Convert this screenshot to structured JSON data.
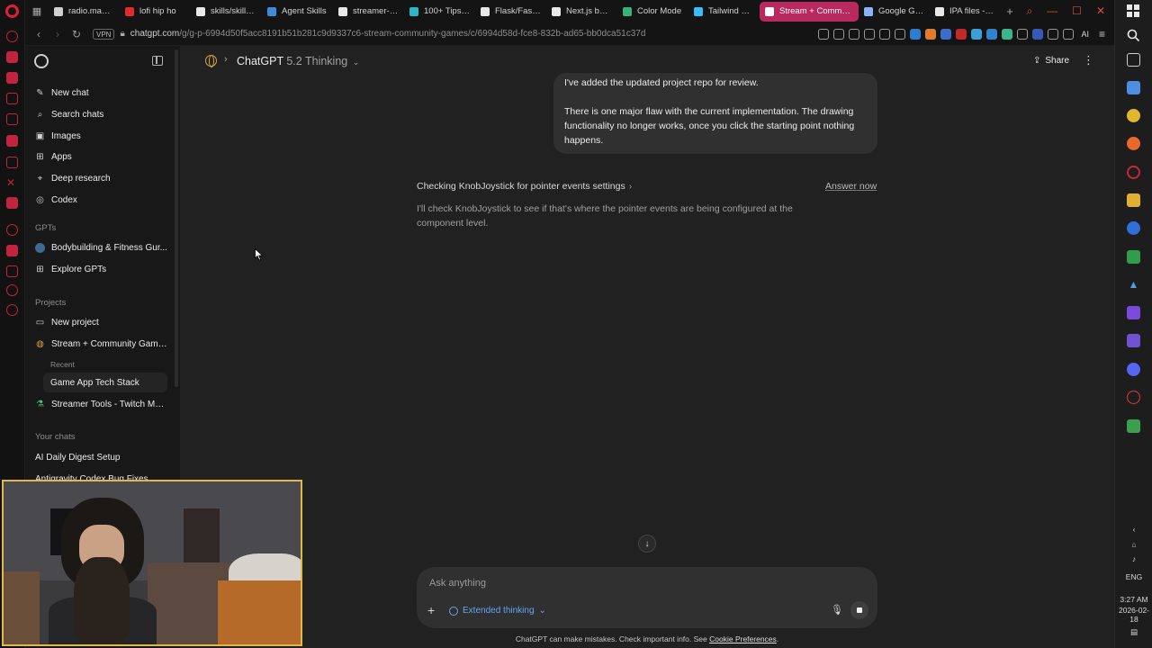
{
  "browser": {
    "tabs": [
      {
        "label": "radio.madza...",
        "color": "#d0d0d0",
        "active": false
      },
      {
        "label": "lofi hip ho",
        "color": "#e22a2a",
        "active": false
      },
      {
        "label": "skills/skills/.c",
        "color": "#e8e8e8",
        "active": false
      },
      {
        "label": "Agent Skills",
        "color": "#3d8bd6",
        "active": false
      },
      {
        "label": "streamer-too",
        "color": "#e8e8e8",
        "active": false
      },
      {
        "label": "100+ Tips: C",
        "color": "#2eb6c8",
        "active": false
      },
      {
        "label": "Flask/FastAP",
        "color": "#e8e8e8",
        "active": false
      },
      {
        "label": "Next.js by Ve",
        "color": "#e8e8e8",
        "active": false
      },
      {
        "label": "Color Mode",
        "color": "#3ab07b",
        "active": false
      },
      {
        "label": "Tailwind CSS",
        "color": "#38bdf8",
        "active": false
      },
      {
        "label": "Stream + Community G",
        "color": "#ffffff",
        "active": true
      },
      {
        "label": "Google Gem",
        "color": "#8ab4f8",
        "active": false
      },
      {
        "label": "IPA files - Go",
        "color": "#e8e8e8",
        "active": false
      }
    ],
    "vpn_label": "VPN",
    "url_host": "chatgpt.com",
    "url_path": "/g/g-p-6994d50f5acc8191b51b281c9d9337c6-stream-community-games/c/6994d58d-fce8-832b-ad65-bb0dca51c37d",
    "ai_label": "AI",
    "accent_color": "#b8295d"
  },
  "sidebar": {
    "items": [
      {
        "label": "New chat",
        "icon": "compose-icon"
      },
      {
        "label": "Search chats",
        "icon": "search-icon"
      },
      {
        "label": "Images",
        "icon": "image-icon"
      },
      {
        "label": "Apps",
        "icon": "apps-icon"
      },
      {
        "label": "Deep research",
        "icon": "telescope-icon"
      },
      {
        "label": "Codex",
        "icon": "codex-icon"
      }
    ],
    "gpts_heading": "GPTs",
    "gpts": [
      {
        "label": "Bodybuilding & Fitness Gur...",
        "icon": "gpt-avatar-icon"
      },
      {
        "label": "Explore GPTs",
        "icon": "grid-icon"
      }
    ],
    "projects_heading": "Projects",
    "projects": [
      {
        "label": "New project",
        "icon": "folder-plus-icon"
      },
      {
        "label": "Stream + Community Games",
        "icon": "globe-icon"
      }
    ],
    "recent_heading": "Recent",
    "recent": [
      {
        "label": "Game App Tech Stack",
        "selected": true
      }
    ],
    "other_projects": [
      {
        "label": "Streamer Tools - Twitch Mar...",
        "icon": "flask-icon"
      }
    ],
    "your_chats_heading": "Your chats",
    "chats": [
      {
        "label": "AI Daily Digest Setup"
      },
      {
        "label": "Antigravity Codex Bug Fixes"
      }
    ]
  },
  "header": {
    "model_name": "ChatGPT",
    "model_version": "5.2 Thinking",
    "share_label": "Share"
  },
  "conversation": {
    "user_message": [
      "I've added the updated project repo for review.",
      "There is one major flaw with the current implementation. The drawing functionality no longer works, once you click the starting point nothing happens."
    ],
    "thinking_title": "Checking KnobJoystick for pointer events settings",
    "answer_now_label": "Answer now",
    "thinking_body": "I'll check KnobJoystick to see if that's where the pointer events are being configured at the component level."
  },
  "composer": {
    "placeholder": "Ask anything",
    "mode_label": "Extended thinking",
    "mode_color": "#62a6f5"
  },
  "footer": {
    "note": "ChatGPT can make mistakes. Check important info. See",
    "link": "Cookie Preferences",
    "end": "."
  },
  "taskbar": {
    "language": "ENG",
    "time": "3:27 AM",
    "date": "2026-02-18"
  }
}
